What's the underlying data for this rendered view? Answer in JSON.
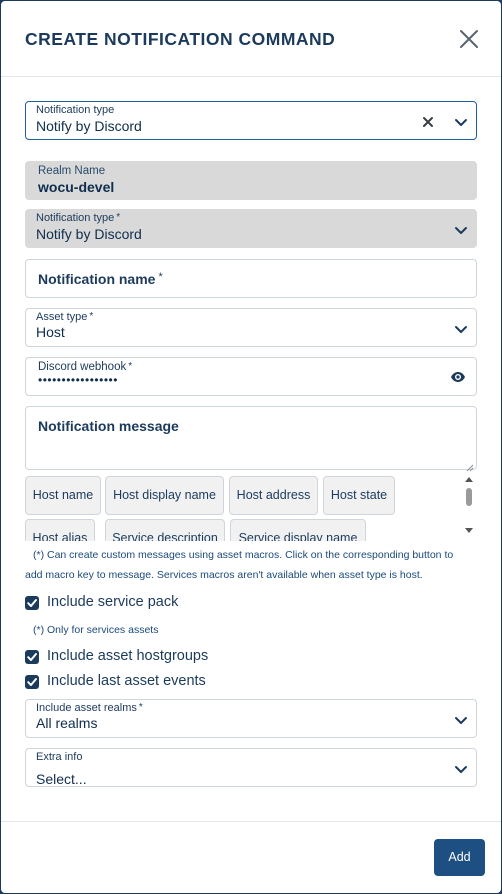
{
  "modal": {
    "title": "CREATE NOTIFICATION COMMAND"
  },
  "filter": {
    "label": "Notification type",
    "value": "Notify by Discord"
  },
  "realm": {
    "label": "Realm Name",
    "value": "wocu-devel"
  },
  "notification_type": {
    "label": "Notification type",
    "required": "*",
    "value": "Notify by Discord"
  },
  "notification_name": {
    "placeholder": "Notification name",
    "required": "*"
  },
  "asset_type": {
    "label": "Asset type",
    "required": "*",
    "value": "Host"
  },
  "discord_webhook": {
    "label": "Discord webhook",
    "required": "*",
    "value": "•••••••••••••••••"
  },
  "notification_message": {
    "placeholder": "Notification message"
  },
  "macros": [
    "Host name",
    "Host display name",
    "Host address",
    "Host state",
    "Host alias",
    "Service description",
    "Service display name"
  ],
  "macro_note": {
    "line1": "(*) Can create custom messages using asset macros. Click on the corresponding button to",
    "line2": "add macro key to message. Services macros aren't available when asset type is host."
  },
  "include_service_pack": {
    "label": "Include service pack",
    "checked": true
  },
  "service_note": "(*) Only for services assets",
  "include_asset_hostgroups": {
    "label": "Include asset hostgroups",
    "checked": true
  },
  "include_last_asset_events": {
    "label": "Include last asset events",
    "checked": true
  },
  "include_asset_realms": {
    "label": "Include asset realms",
    "required": "*",
    "value": "All realms"
  },
  "extra_info": {
    "label": "Extra info",
    "value": "Select..."
  },
  "footer": {
    "add_label": "Add"
  },
  "colors": {
    "primary": "#1b3a5c",
    "button": "#1e4f82",
    "focus": "#1e5fa0",
    "disabled": "#d9d9d9"
  }
}
